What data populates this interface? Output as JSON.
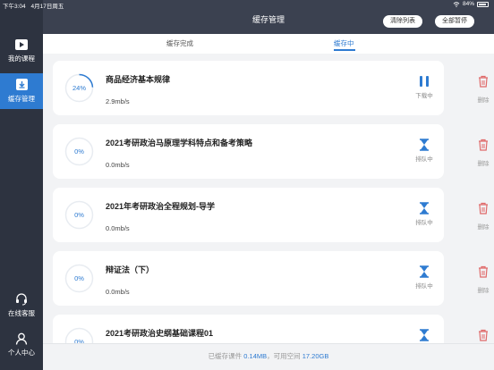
{
  "status_bar": {
    "time": "下午3:04",
    "date": "4月17日周五",
    "battery": "84%"
  },
  "sidebar": {
    "items": [
      {
        "label": "我的课程",
        "icon": "play-icon"
      },
      {
        "label": "缓存管理",
        "icon": "download-icon",
        "active": true
      },
      {
        "label": "在线客服",
        "icon": "headset-icon"
      },
      {
        "label": "个人中心",
        "icon": "user-icon"
      }
    ]
  },
  "header": {
    "title": "缓存管理",
    "clear_label": "清除列表",
    "pause_all_label": "全部暂停"
  },
  "tabs": [
    {
      "label": "缓存完成"
    },
    {
      "label": "缓存中",
      "active": true
    }
  ],
  "downloads": [
    {
      "title": "商品经济基本规律",
      "progress": "24%",
      "progress_value": 0.24,
      "speed": "2.9mb/s",
      "action": "下载中",
      "action_icon": "pause-icon",
      "delete": "删除"
    },
    {
      "title": "2021考研政治马原理学科特点和备考策略",
      "progress": "0%",
      "progress_value": 0,
      "speed": "0.0mb/s",
      "action": "排队中",
      "action_icon": "hourglass-icon",
      "delete": "删除"
    },
    {
      "title": "2021年考研政治全程规划-导学",
      "progress": "0%",
      "progress_value": 0,
      "speed": "0.0mb/s",
      "action": "排队中",
      "action_icon": "hourglass-icon",
      "delete": "删除"
    },
    {
      "title": "辩证法（下）",
      "progress": "0%",
      "progress_value": 0,
      "speed": "0.0mb/s",
      "action": "排队中",
      "action_icon": "hourglass-icon",
      "delete": "删除"
    },
    {
      "title": "2021考研政治史纲基础课程01",
      "progress": "0%",
      "progress_value": 0,
      "speed": "",
      "action": "",
      "action_icon": "hourglass-icon",
      "delete": ""
    }
  ],
  "footer": {
    "cached_label": "已缓存课件",
    "cached_value": "0.14MB",
    "sep": "，可用空间",
    "free_value": "17.20GB"
  },
  "colors": {
    "accent": "#2e7bd1",
    "sidebar": "#2d3340",
    "header": "#3b4150",
    "delete": "#e06a6a"
  }
}
